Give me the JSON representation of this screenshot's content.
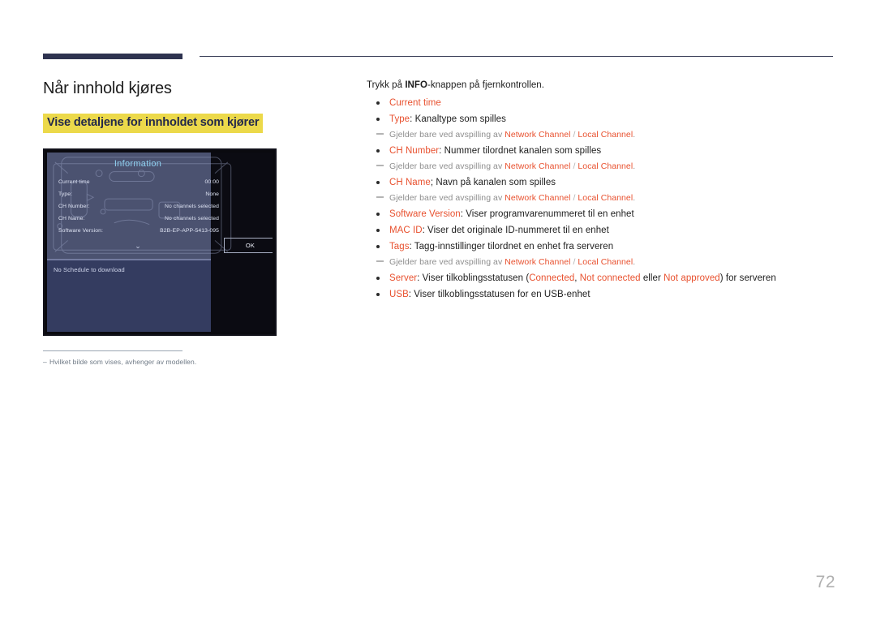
{
  "document": {
    "page_number": "72",
    "figure_note_dash": "–",
    "figure_note": "Hvilket bilde som vises, avhenger av modellen."
  },
  "left": {
    "title": "Når innhold kjøres",
    "subtitle": "Vise detaljene for innholdet som kjører"
  },
  "tv": {
    "dialog_title": "Information",
    "rows": [
      {
        "label": "Current time",
        "value": "00:00"
      },
      {
        "label": "Type:",
        "value": "None"
      },
      {
        "label": "CH Number:",
        "value": "No channels selected"
      },
      {
        "label": "CH Name:",
        "value": "No channels selected"
      },
      {
        "label": "Software Version:",
        "value": "B2B-EP-APP-5413-095"
      }
    ],
    "chevron": "⌄",
    "ok_button": "OK",
    "schedule_text": "No Schedule to download"
  },
  "right": {
    "intro_before": "Trykk på ",
    "intro_bold": "INFO",
    "intro_after": "-knappen på fjernkontrollen.",
    "items": [
      {
        "kind": "bullet",
        "keyword": "Current time",
        "rest": ""
      },
      {
        "kind": "bullet",
        "keyword": "Type",
        "rest": ": Kanaltype som spilles"
      },
      {
        "kind": "note",
        "prefix": "Gjelder bare ved avspilling av ",
        "kw1": "Network Channel",
        "sep": " / ",
        "kw2": "Local Channel",
        "suffix": "."
      },
      {
        "kind": "bullet",
        "keyword": "CH Number",
        "rest": ": Nummer tilordnet kanalen som spilles"
      },
      {
        "kind": "note",
        "prefix": "Gjelder bare ved avspilling av ",
        "kw1": "Network Channel",
        "sep": " / ",
        "kw2": "Local Channel",
        "suffix": "."
      },
      {
        "kind": "bullet",
        "keyword": "CH Name",
        "rest": "; Navn på kanalen som spilles"
      },
      {
        "kind": "note",
        "prefix": "Gjelder bare ved avspilling av ",
        "kw1": "Network Channel",
        "sep": " / ",
        "kw2": "Local Channel",
        "suffix": "."
      },
      {
        "kind": "bullet",
        "keyword": "Software Version",
        "rest": ": Viser programvarenummeret til en enhet"
      },
      {
        "kind": "bullet",
        "keyword": "MAC ID",
        "rest": ": Viser det originale ID-nummeret til en enhet"
      },
      {
        "kind": "bullet",
        "keyword": "Tags",
        "rest": ": Tagg-innstillinger tilordnet en enhet fra serveren"
      },
      {
        "kind": "note",
        "prefix": "Gjelder bare ved avspilling av ",
        "kw1": "Network Channel",
        "sep": " / ",
        "kw2": "Local Channel",
        "suffix": "."
      },
      {
        "kind": "bullet-server",
        "keyword": "Server",
        "seg1": ": Viser tilkoblingsstatusen (",
        "kw1": "Connected",
        "seg2": ", ",
        "kw2": "Not connected",
        "seg3": " eller ",
        "kw3": "Not approved",
        "seg4": ") for serveren"
      },
      {
        "kind": "bullet",
        "keyword": "USB",
        "rest": ": Viser tilkoblingsstatusen for en USB-enhet"
      }
    ]
  },
  "colors": {
    "accent_navy": "#2e3350",
    "highlight_yellow": "#ecd94a",
    "keyword_red": "#e8512f",
    "note_gray": "#8e8e8e"
  }
}
